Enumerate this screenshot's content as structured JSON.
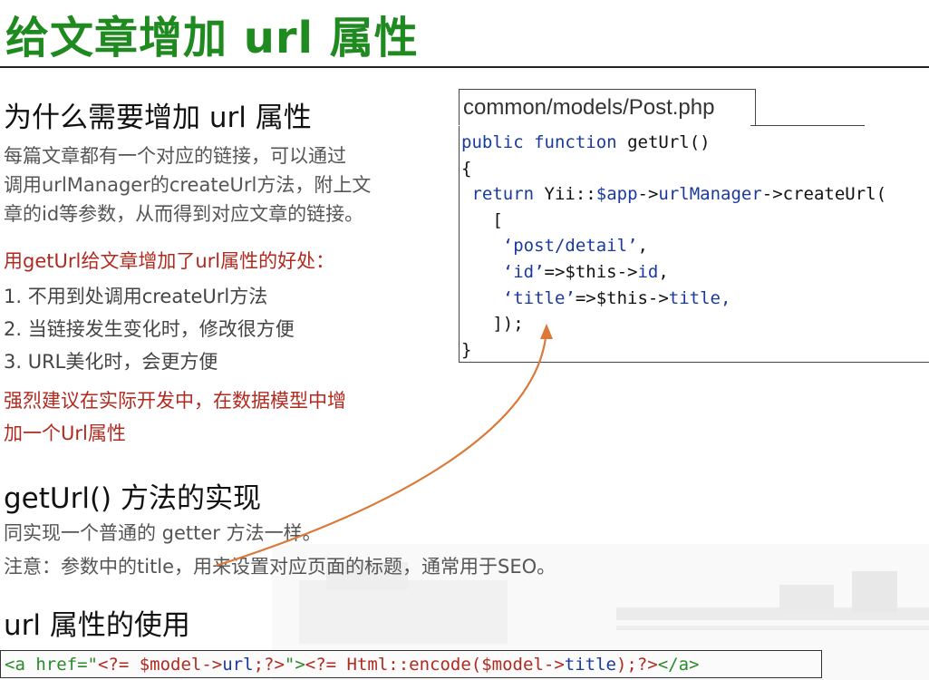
{
  "slide": {
    "title": "给文章增加 url 属性",
    "section1": {
      "heading": "为什么需要增加 url 属性",
      "para_lines": [
        "每篇文章都有一个对应的链接，可以通过",
        "调用urlManager的createUrl方法，附上文",
        "章的id等参数，从而得到对应文章的链接。"
      ],
      "benefit_heading": "用getUrl给文章增加了url属性的好处：",
      "benefits": [
        "1.  不用到处调用createUrl方法",
        "2.  当链接发生变化时，修改很方便",
        "3.  URL美化时，会更方便"
      ],
      "recommend_lines": [
        "强烈建议在实际开发中，在数据模型中增",
        "加一个Url属性"
      ]
    },
    "section2": {
      "heading": "getUrl() 方法的实现",
      "line1": "同实现一个普通的 getter 方法一样。",
      "line2": "注意：参数中的title，用来设置对应页面的标题，通常用于SEO。"
    },
    "section3": {
      "heading": "url 属性的使用"
    },
    "code_file": "common/models/Post.php",
    "bottom_code": {
      "open": "<a href=\"",
      "php1": "<?= $model->",
      "url": "url",
      "php1_end": ";?>",
      "close_attr": "\">",
      "php2": "<?= Html::encode($model->",
      "title": "title",
      "php2_end": ");?>",
      "end_tag": "</a>"
    },
    "colors": {
      "title_green": "#1f8a1f",
      "accent_red": "#b22a1f",
      "code_blue": "#1a3a9e",
      "arrow_orange": "#d9793a"
    }
  },
  "code_tokens": {
    "l1_kw1": "public",
    "l1_kw2": "function",
    "l1_name": "getUrl()",
    "l2": "{",
    "l3_kw": "return",
    "l3_cls": "Yii::",
    "l3_app": "$app",
    "l3_arrow": "->",
    "l3_um": "urlManager",
    "l3_rest": "->createUrl(",
    "l4": "[",
    "l5_str": "‘post/detail’",
    "l5_comma": ",",
    "l6_str": "‘id’",
    "l6_mid": "=>$this->",
    "l6_prop": "id",
    "l6_comma": ",",
    "l7_str": "‘title’",
    "l7_mid": "=>$this->",
    "l7_prop": "title,",
    "l8": "]);",
    "l9": "}"
  }
}
